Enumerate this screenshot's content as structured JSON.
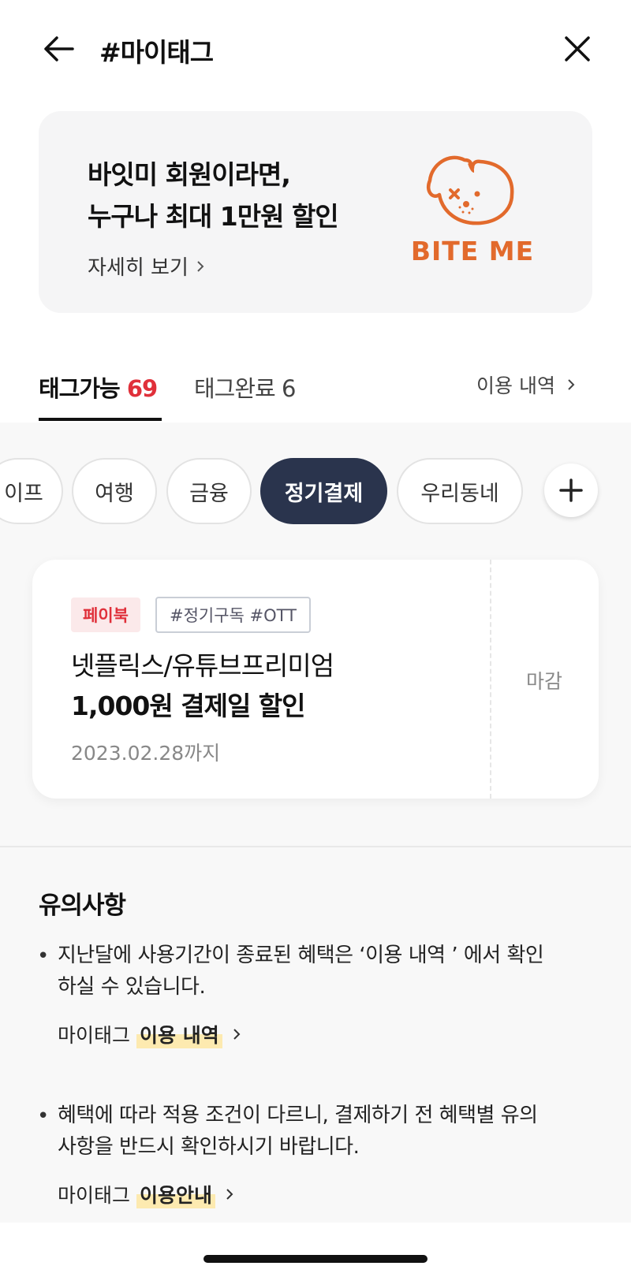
{
  "header": {
    "title": "#마이태그"
  },
  "banner": {
    "line1": "바잇미 회원이라면,",
    "line2": "누구나 최대 1만원 할인",
    "more": "자세히 보기",
    "logo_text": "BITE ME"
  },
  "tabs": {
    "available_label": "태그가능",
    "available_count": "69",
    "done_label": "태그완료 6",
    "history": "이용 내역"
  },
  "chips": [
    "이프",
    "여행",
    "금융",
    "정기결제",
    "우리동네"
  ],
  "card": {
    "brand": "페이북",
    "hashtags": "#정기구독 #OTT",
    "title1": "넷플릭스/유튜브프리미엄",
    "title2": "1,000원 결제일 할인",
    "date": "2023.02.28까지",
    "status": "마감"
  },
  "notes": {
    "title": "유의사항",
    "items": [
      {
        "bullet": "•",
        "line1": "지난달에 사용기간이 종료된 혜택은 ‘이용 내역 ’ 에서 확인",
        "line2": "하실 수 있습니다.",
        "link_prefix": "마이태그",
        "link_hl": "이용 내역"
      },
      {
        "bullet": "•",
        "line1": "혜택에 따라 적용 조건이 다르니, 결제하기 전 혜택별 유의",
        "line2": "사항을 반드시 확인하시기 바랍니다.",
        "link_prefix": "마이태그",
        "link_hl": "이용안내"
      }
    ]
  },
  "colors": {
    "accent_red": "#e0303a",
    "active_chip": "#2a344d",
    "brand_orange": "#e26a2c",
    "highlight": "#fdeab0"
  }
}
